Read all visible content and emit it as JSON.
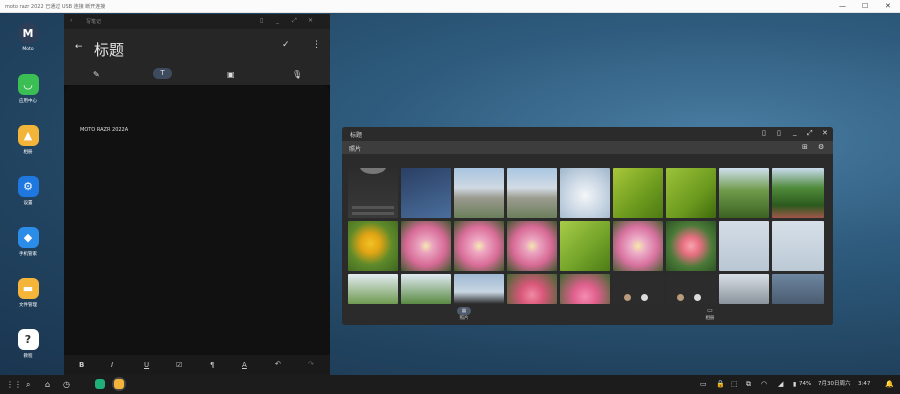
{
  "titlebar": {
    "title": "moto razr 2022 已通过 USB 连接 断开连接",
    "minimize": "—",
    "maximize": "☐",
    "close": "✕"
  },
  "desktop_icons": [
    {
      "label": "Moto",
      "icon": "moto-icon",
      "color": "#2f3e57",
      "glyph": "M"
    },
    {
      "label": "应用中心",
      "icon": "app-center-icon",
      "color": "#3bbf54",
      "glyph": "◡"
    },
    {
      "label": "相册",
      "icon": "gallery-icon",
      "color": "#f2b53a",
      "glyph": "▲"
    },
    {
      "label": "设置",
      "icon": "settings-icon",
      "color": "#1e78e0",
      "glyph": "⚙"
    },
    {
      "label": "手机管家",
      "icon": "phone-manager-icon",
      "color": "#2c8de9",
      "glyph": "◆"
    },
    {
      "label": "文件管理",
      "icon": "file-manager-icon",
      "color": "#f5b43a",
      "glyph": "▬"
    },
    {
      "label": "教程",
      "icon": "help-icon",
      "color": "#ffffff",
      "glyph": "?"
    }
  ],
  "notes": {
    "window_title": "写笔记",
    "title_placeholder": "标题",
    "body_text": "MOTO RAZR 2022A",
    "format_tools": [
      "B",
      "I",
      "U",
      "☑",
      "¶",
      "A",
      "↶",
      "↷"
    ]
  },
  "gallery": {
    "title": "标题",
    "subtitle": "照片",
    "tabs": [
      {
        "label": "照片",
        "active": true
      },
      {
        "label": "相册",
        "active": false
      }
    ]
  },
  "taskbar": {
    "battery": "74%",
    "date": "7月30日周六",
    "time": "3:47"
  }
}
